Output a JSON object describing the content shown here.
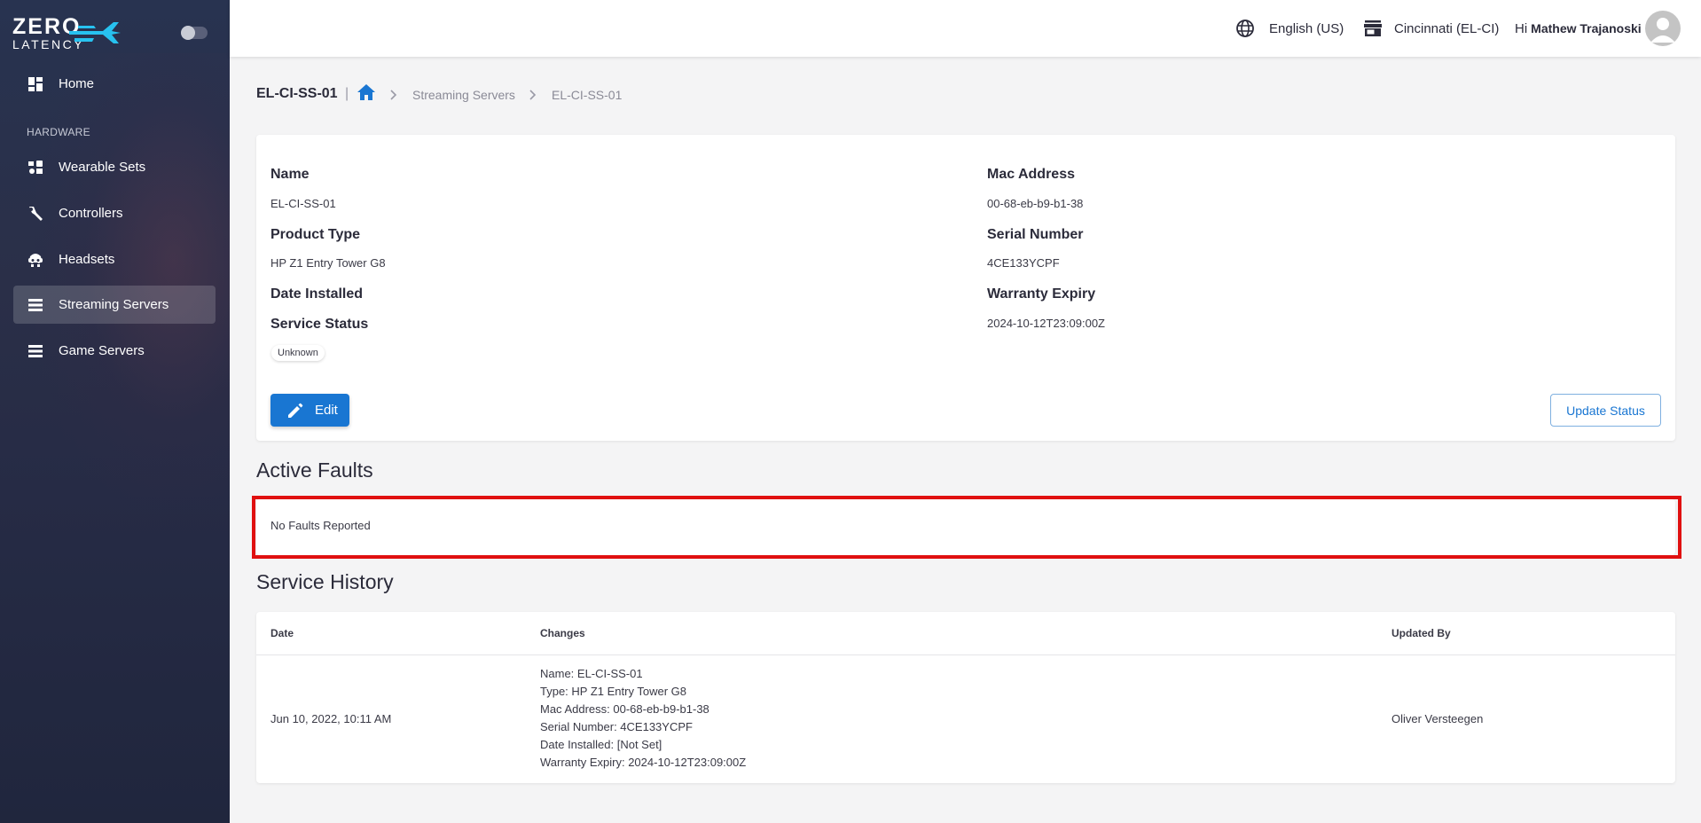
{
  "brand": {
    "line1": "ZERO",
    "line2": "LATENCY"
  },
  "sidebar": {
    "section_label": "HARDWARE",
    "items": [
      {
        "label": "Home",
        "icon": "dashboard-icon",
        "active": false
      },
      {
        "label": "Wearable Sets",
        "icon": "wearable-set-icon",
        "active": false
      },
      {
        "label": "Controllers",
        "icon": "controller-icon",
        "active": false
      },
      {
        "label": "Headsets",
        "icon": "headset-icon",
        "active": false
      },
      {
        "label": "Streaming Servers",
        "icon": "server-icon",
        "active": true
      },
      {
        "label": "Game Servers",
        "icon": "server-icon",
        "active": false
      }
    ]
  },
  "topbar": {
    "language": "English (US)",
    "location": "Cincinnati (EL-CI)",
    "greeting": "Hi",
    "user_name": "Mathew Trajanoski"
  },
  "breadcrumb": {
    "title": "EL-CI-SS-01",
    "separator": "|",
    "items": [
      "Streaming Servers",
      "EL-CI-SS-01"
    ]
  },
  "details": {
    "name_label": "Name",
    "name_value": "EL-CI-SS-01",
    "product_type_label": "Product Type",
    "product_type_value": "HP Z1 Entry Tower G8",
    "date_installed_label": "Date Installed",
    "service_status_label": "Service Status",
    "service_status_value": "Unknown",
    "mac_label": "Mac Address",
    "mac_value": "00-68-eb-b9-b1-38",
    "serial_label": "Serial Number",
    "serial_value": "4CE133YCPF",
    "warranty_label": "Warranty Expiry",
    "warranty_value": "2024-10-12T23:09:00Z",
    "edit_label": "Edit",
    "update_status_label": "Update Status"
  },
  "faults": {
    "title": "Active Faults",
    "empty_text": "No Faults Reported"
  },
  "history": {
    "title": "Service History",
    "columns": [
      "Date",
      "Changes",
      "Updated By"
    ],
    "rows": [
      {
        "date": "Jun 10, 2022, 10:11 AM",
        "changes": [
          "Name: EL-CI-SS-01",
          "Type: HP Z1 Entry Tower G8",
          "Mac Address: 00-68-eb-b9-b1-38",
          "Serial Number: 4CE133YCPF",
          "Date Installed: [Not Set]",
          "Warranty Expiry: 2024-10-12T23:09:00Z"
        ],
        "updated_by": "Oliver Versteegen"
      }
    ]
  },
  "colors": {
    "accent": "#1976d2",
    "sidebar": "#262b45",
    "highlight": "#e01010"
  }
}
